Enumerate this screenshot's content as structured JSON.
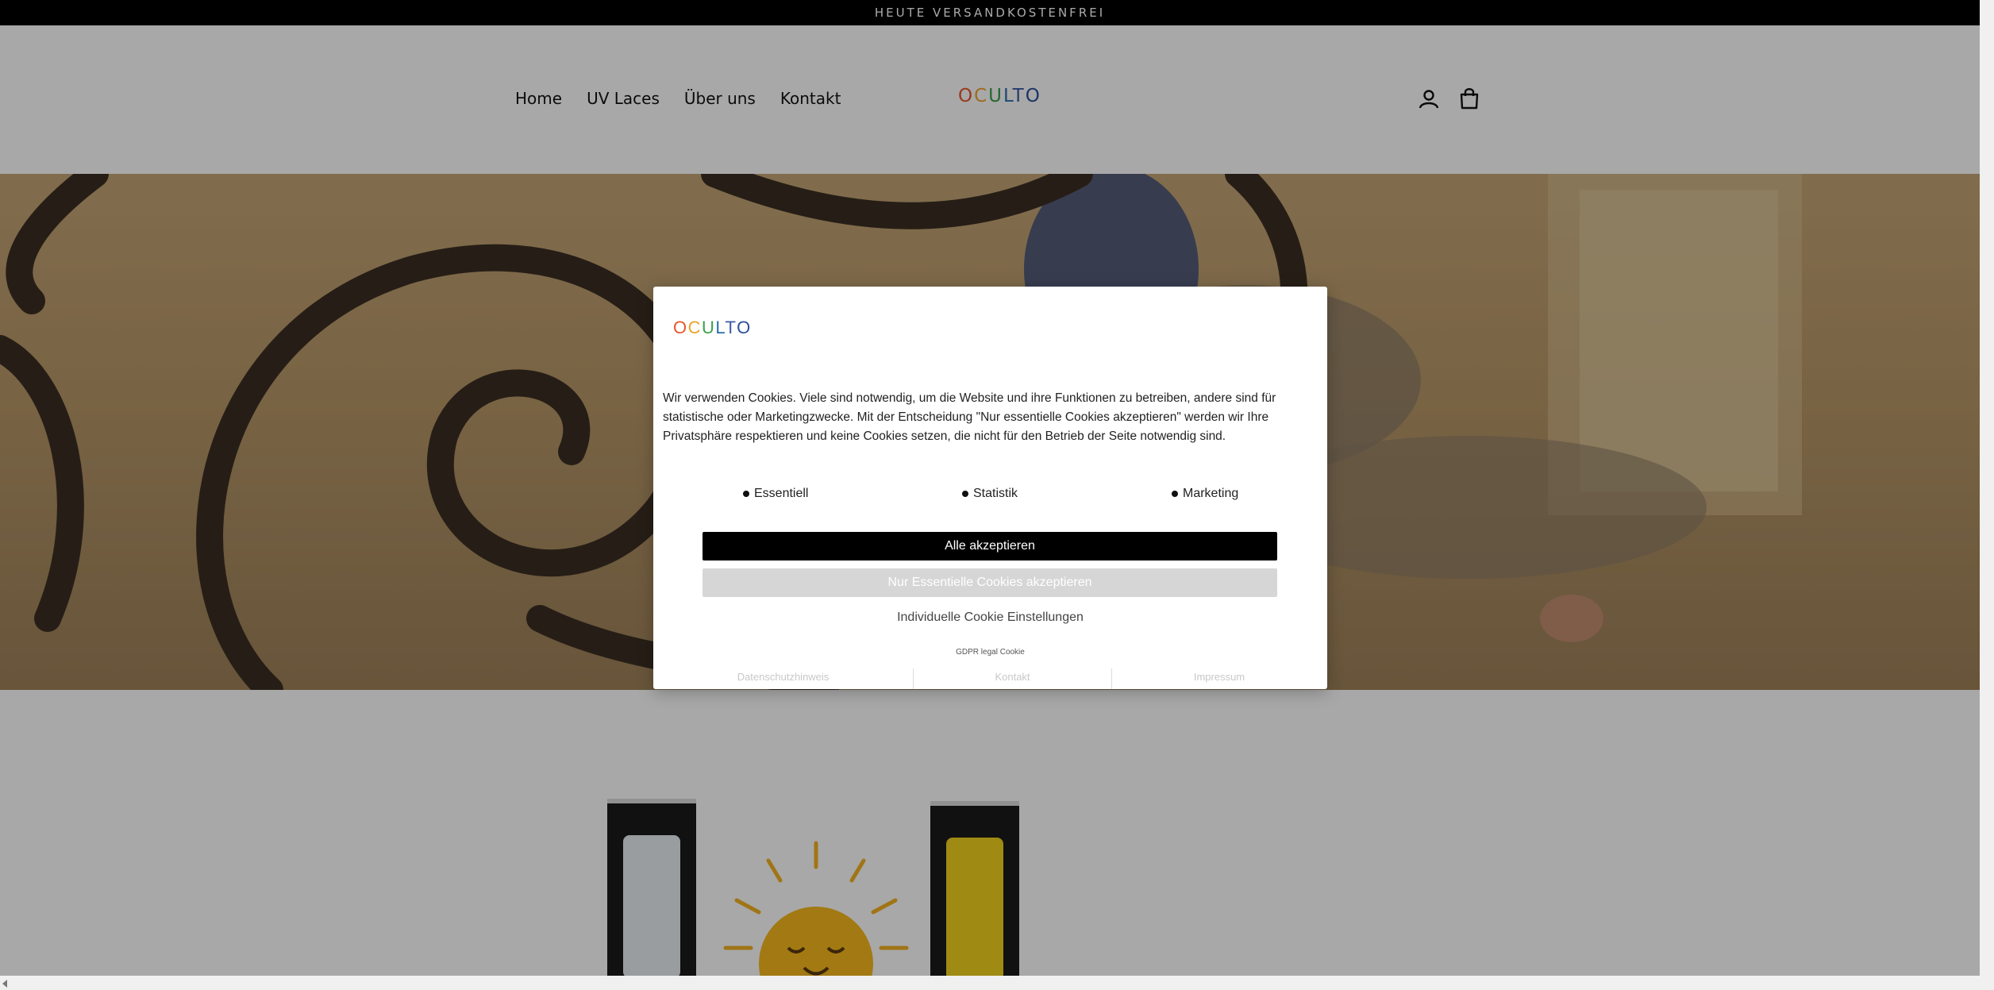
{
  "announcement": "HEUTE VERSANDKOSTENFREI",
  "nav": {
    "items": [
      "Home",
      "UV Laces",
      "Über uns",
      "Kontakt"
    ]
  },
  "logo": {
    "letters": [
      "O",
      "C",
      "U",
      "L",
      "T",
      "O"
    ],
    "colors": [
      "#e8552a",
      "#f0a32a",
      "#3aa04a",
      "#2d6cb0",
      "#3c5aa8",
      "#2b4f9a"
    ]
  },
  "header_icons": [
    "account-icon",
    "cart-icon"
  ],
  "cookie": {
    "text": "Wir verwenden Cookies. Viele sind notwendig, um die Website und ihre Funktionen zu betreiben, andere sind für statistische oder Marketingzwecke. Mit der Entscheidung \"Nur essentielle Cookies akzeptieren\" werden wir Ihre Privatsphäre respektieren und keine Cookies setzen, die nicht für den Betrieb der Seite notwendig sind.",
    "categories": [
      "Essentiell",
      "Statistik",
      "Marketing"
    ],
    "accept_all": "Alle akzeptieren",
    "accept_essential": "Nur Essentielle Cookies akzeptieren",
    "individual": "Individuelle Cookie Einstellungen",
    "gdpr": "GDPR legal Cookie",
    "footer_links": [
      "Datenschutzhinweis",
      "Kontakt",
      "Impressum"
    ]
  },
  "colors": {
    "accent_black": "#000000",
    "disabled_button": "#d6d6d6",
    "overlay": "rgba(0,0,0,0.34)"
  }
}
